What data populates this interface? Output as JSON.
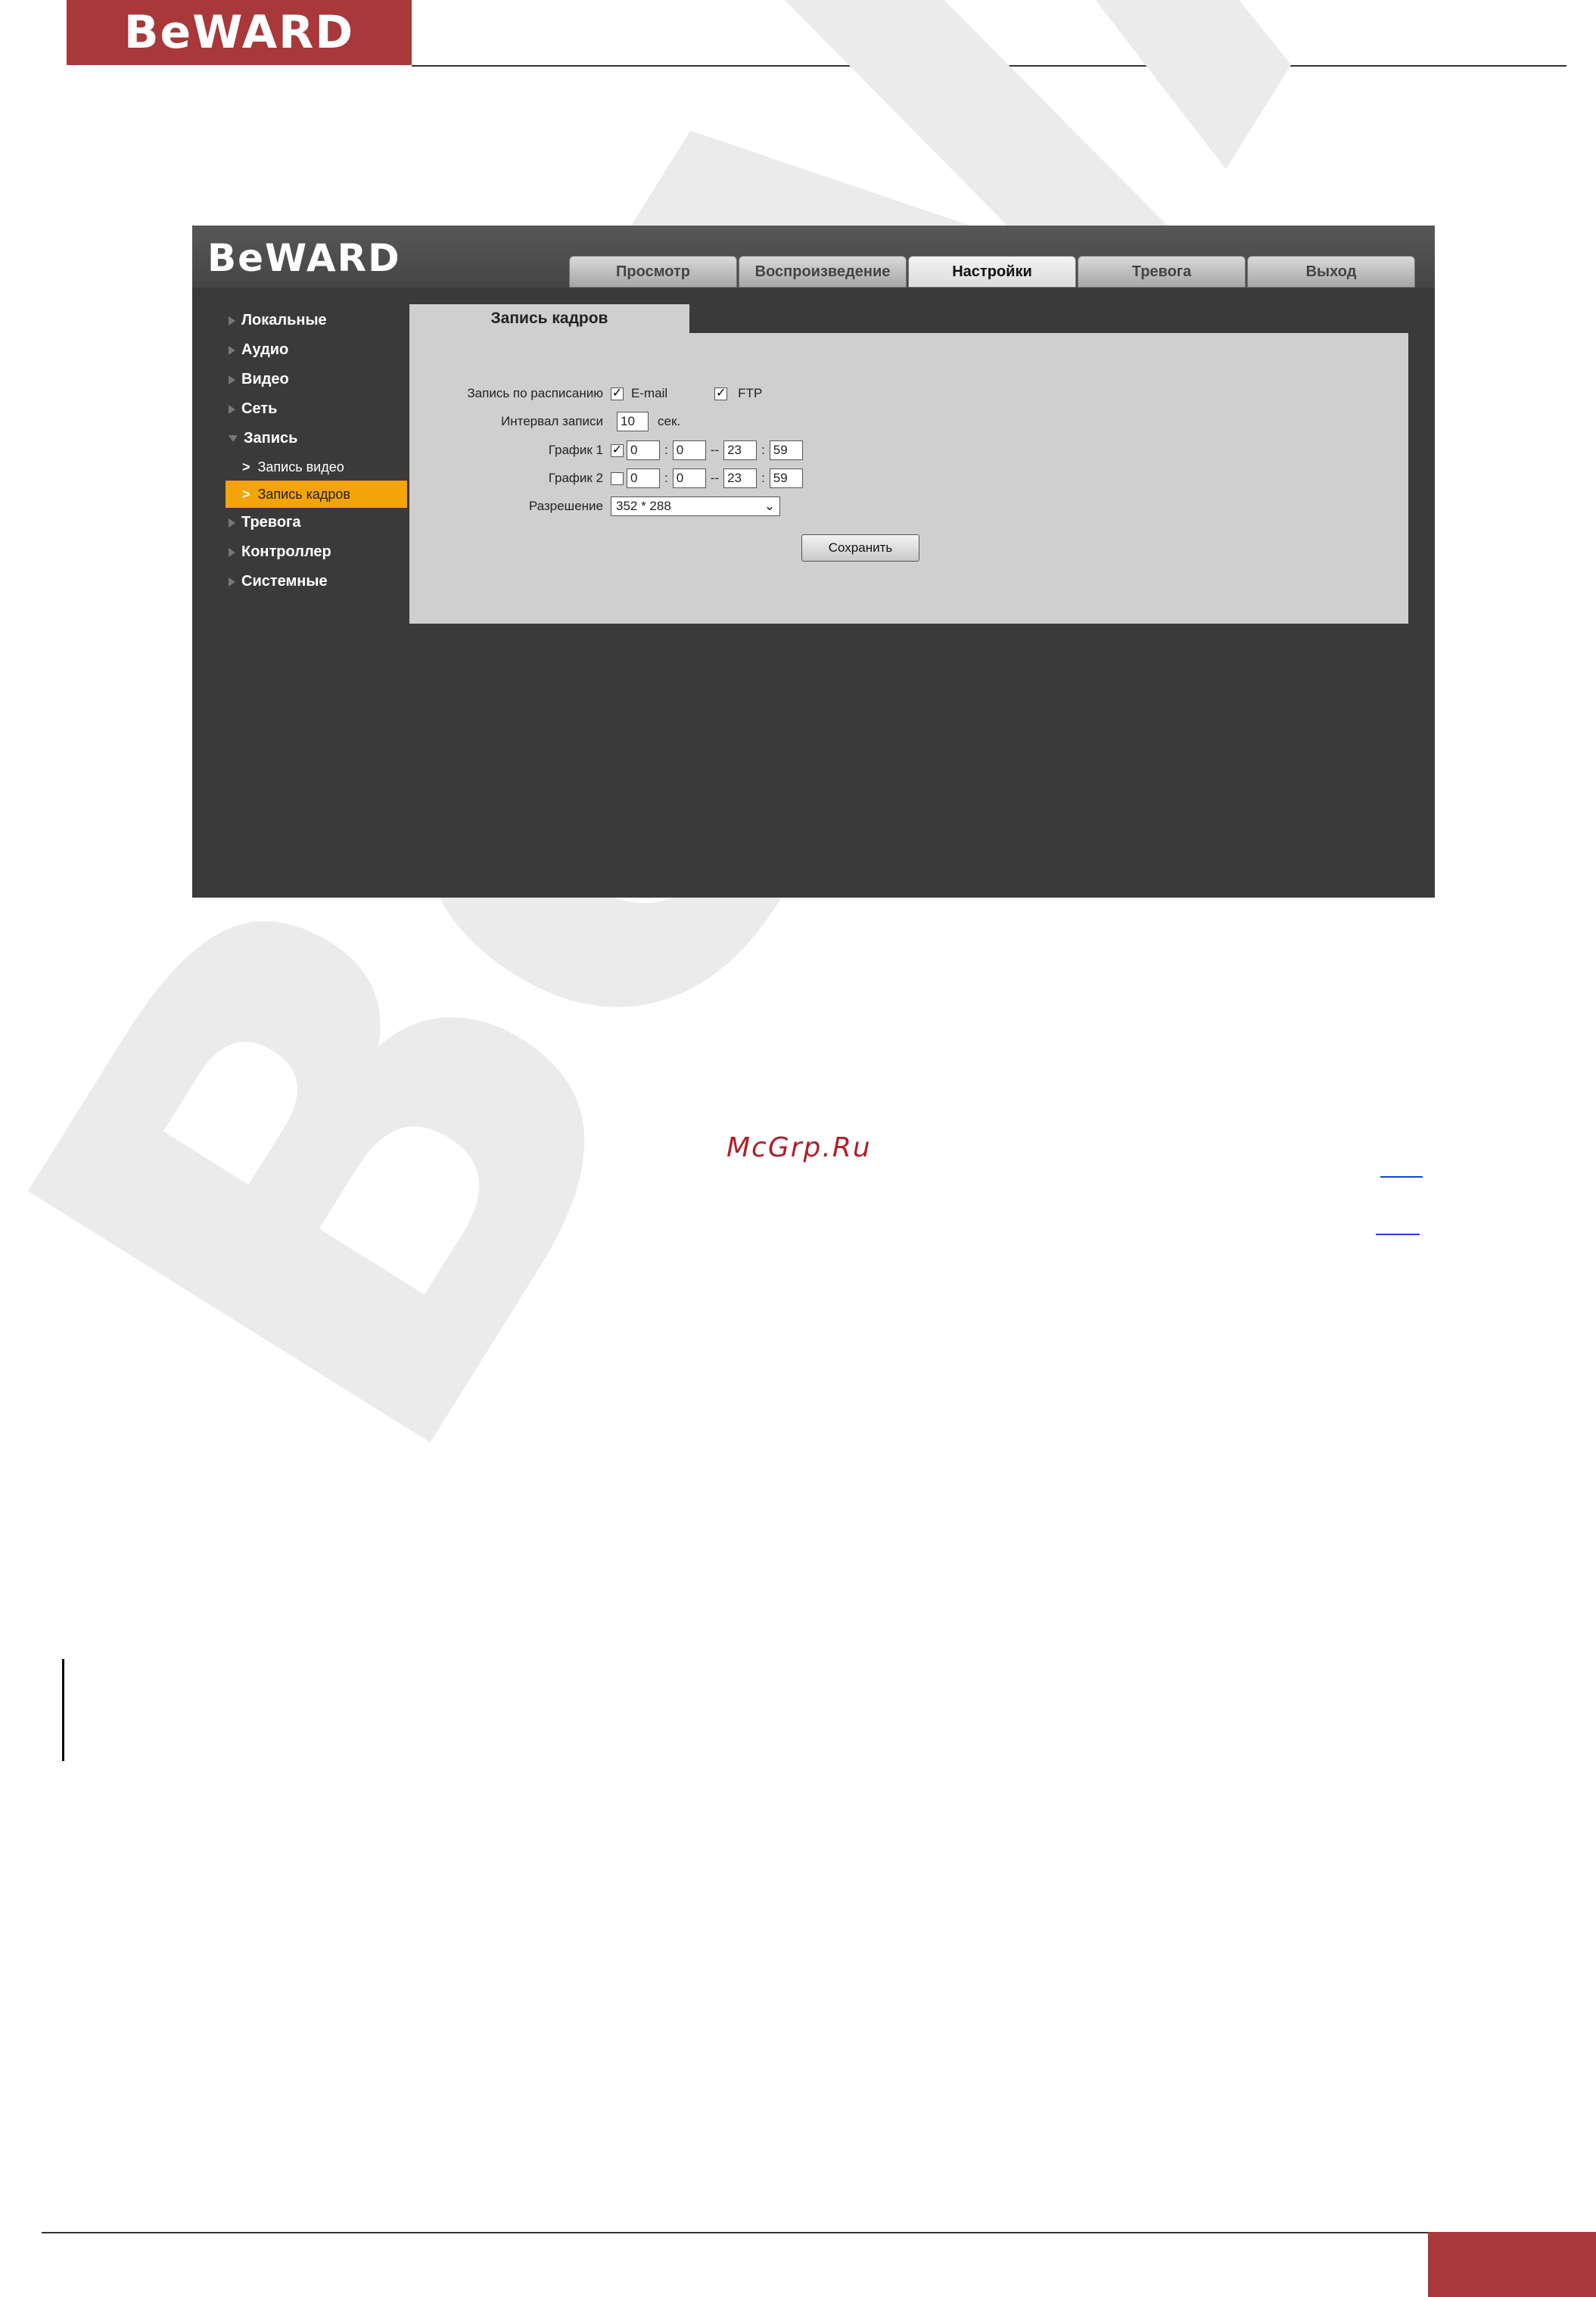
{
  "doc": {
    "logo": "BeWARD",
    "watermark": "BeWARD",
    "site_link": "McGrp.Ru"
  },
  "app": {
    "logo": "BeWARD",
    "tabs": [
      {
        "label": "Просмотр",
        "active": false
      },
      {
        "label": "Воспроизведение",
        "active": false
      },
      {
        "label": "Настройки",
        "active": true
      },
      {
        "label": "Тревога",
        "active": false
      },
      {
        "label": "Выход",
        "active": false
      }
    ],
    "sidebar": {
      "items": [
        {
          "label": "Локальные"
        },
        {
          "label": "Аудио"
        },
        {
          "label": "Видео"
        },
        {
          "label": "Сеть"
        },
        {
          "label": "Запись",
          "expanded": true
        },
        {
          "label": "Тревога"
        },
        {
          "label": "Контроллер"
        },
        {
          "label": "Системные"
        }
      ],
      "subitems": [
        {
          "label": "Запись видео",
          "active": false
        },
        {
          "label": "Запись кадров",
          "active": true
        }
      ]
    },
    "panel": {
      "title": "Запись кадров",
      "schedule_label": "Запись по расписанию",
      "email_label": "E-mail",
      "email_checked": true,
      "ftp_label": "FTP",
      "ftp_checked": true,
      "interval_label": "Интервал записи",
      "interval_value": "10",
      "interval_unit": "сек.",
      "schedule1": {
        "label": "График 1",
        "enabled": true,
        "start_h": "0",
        "start_m": "0",
        "end_h": "23",
        "end_m": "59"
      },
      "schedule2": {
        "label": "График 2",
        "enabled": false,
        "start_h": "0",
        "start_m": "0",
        "end_h": "23",
        "end_m": "59"
      },
      "resolution_label": "Разрешение",
      "resolution_value": "352 * 288",
      "save_label": "Сохранить",
      "colon": ":",
      "dash": "--"
    }
  }
}
